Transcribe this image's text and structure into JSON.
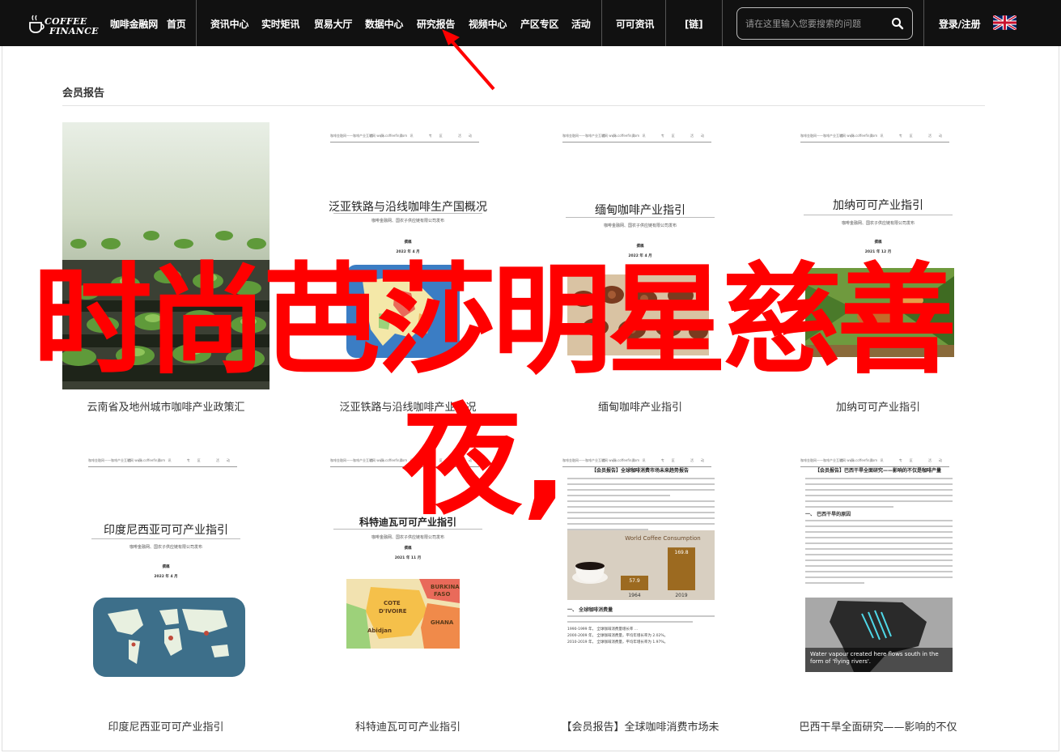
{
  "nav": {
    "logo_line1": "COFFEE",
    "logo_line2": "FINANCE",
    "items": [
      "咖啡金融网",
      "首页",
      "资讯中心",
      "实时矩讯",
      "贸易大厅",
      "数据中心",
      "研究报告",
      "视频中心",
      "产区专区",
      "活动",
      "可可资讯",
      "[链]"
    ],
    "search_placeholder": "请在这里输入您要搜索的问题",
    "login": "登录/注册"
  },
  "section": {
    "title": "会员报告"
  },
  "cards": [
    {
      "caption": "云南省及地州城市咖啡产业政策汇"
    },
    {
      "caption": "泛亚铁路与沿线咖啡产业概况",
      "doc_header": "咖啡金融网——咖啡产业互联网 www.coffeefin.com",
      "doc_menu": "首页 资讯 专区 活动",
      "doc_title": "泛亚铁路与沿线咖啡生产国概况",
      "doc_sub": "咖啡金融网、国农子供应链有限公司发布",
      "doc_author": "撰稿",
      "doc_date": "2022 年 4 月"
    },
    {
      "caption": "缅甸咖啡产业指引",
      "doc_header": "咖啡金融网——咖啡产业互联网 www.coffeefin.com",
      "doc_menu": "首页 资讯 专区 活动",
      "doc_title": "缅甸咖啡产业指引",
      "doc_sub": "咖啡金融网、国农子供应链有限公司发布",
      "doc_author": "撰稿",
      "doc_date": "2022 年 4 月"
    },
    {
      "caption": "加纳可可产业指引",
      "doc_header": "咖啡金融网——咖啡产业互联网 www.coffeefin.com",
      "doc_menu": "首页 资讯 专区 活动",
      "doc_title": "加纳可可产业指引",
      "doc_sub": "咖啡金融网、国农子供应链有限公司发布",
      "doc_author": "撰稿",
      "doc_date": "2021 年 12 月"
    },
    {
      "caption": "印度尼西亚可可产业指引",
      "doc_header": "咖啡金融网——咖啡产业互联网 www.coffeefin.com",
      "doc_menu": "首页 资讯 专区 活动",
      "doc_title": "印度尼西亚可可产业指引",
      "doc_sub": "咖啡金融网、国农子供应链有限公司发布",
      "doc_author": "撰稿",
      "doc_date": "2022 年 4 月"
    },
    {
      "caption": "科特迪瓦可可产业指引",
      "doc_header": "咖啡金融网——咖啡产业互联网 www.coffeefin.com",
      "doc_menu": "首页 资讯 专区 活动",
      "doc_title": "科特迪瓦可可产业指引",
      "doc_sub": "咖啡金融网、国农子供应链有限公司发布",
      "doc_author": "撰稿",
      "doc_date": "2021 年 11 月",
      "map_labels": [
        "BURKINA",
        "FASO",
        "COTE",
        "D'IVOIRE",
        "GHANA",
        "Abidjan"
      ]
    },
    {
      "caption": "【会员报告】全球咖啡消费市场未",
      "doc_header": "咖啡金融网——咖啡产业互联网 www.coffeefin.com",
      "doc_menu": "首页 资讯 专区 活动",
      "doc_title": "【会员报告】全球咖啡消费市场未来趋势报告",
      "chart_title": "World Coffee Consumption",
      "chart_unit": "(million bags)",
      "section_heading": "一、 全球咖啡消费量",
      "stat_lines": [
        "1990-1999 年， 全球咖啡消费量增长率 ...",
        "2000-2009 年， 全球咖啡消费量，平均年增长率为 2.02%。",
        "2010-2019 年， 全球咖啡消费量，平均年增长率为 1.97%。"
      ]
    },
    {
      "caption": "巴西干旱全面研究——影响的不仅",
      "doc_header": "咖啡金融网——咖啡产业互联网 www.coffeefin.com",
      "doc_menu": "首页 资讯 专区 活动",
      "doc_title": "【会员报告】巴西干旱全面研究——影响的不仅是咖啡产量",
      "doc_section_heading": "一、 巴西干旱的原因",
      "vapour_caption": "Water vapour created here flows south in the form of 'flying rivers'."
    }
  ],
  "chart_data": {
    "type": "bar",
    "title": "World Coffee Consumption",
    "categories": [
      "1964",
      "2019"
    ],
    "values": [
      57.9,
      169.8
    ],
    "ylabel": "(million bags)",
    "ylim": [
      0,
      180
    ]
  },
  "overlay": {
    "line1": "时尚芭莎明星慈善",
    "line2": "夜,"
  },
  "colors": {
    "nav_bg": "#111111",
    "overlay": "#ff0000",
    "arrow": "#ff0000"
  }
}
